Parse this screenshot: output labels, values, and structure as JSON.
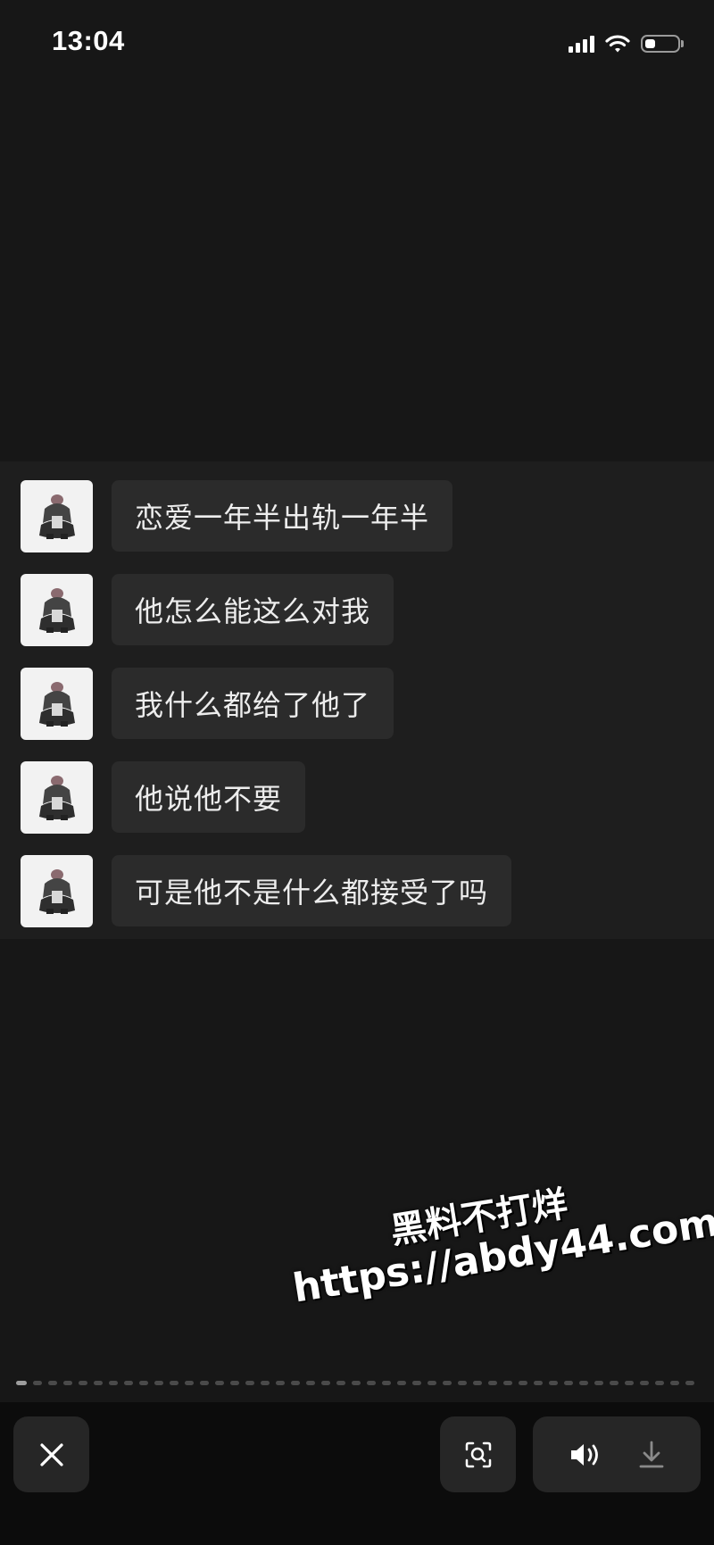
{
  "status_bar": {
    "time": "13:04",
    "icons": [
      "cellular-signal-icon",
      "wifi-icon",
      "battery-icon"
    ]
  },
  "chat": {
    "messages": [
      {
        "text": "恋爱一年半出轨一年半"
      },
      {
        "text": "他怎么能这么对我"
      },
      {
        "text": "我什么都给了他了"
      },
      {
        "text": "他说他不要"
      },
      {
        "text": "可是他不是什么都接受了吗"
      }
    ]
  },
  "watermark": {
    "line1": "黑料不打烊",
    "line2": "https://abdy44.com"
  },
  "bottom_bar": {
    "buttons": [
      "close-icon",
      "scan-search-icon",
      "volume-icon",
      "download-icon"
    ]
  },
  "colors": {
    "background": "#171717",
    "chat_panel": "#1e1e1e",
    "bubble": "#2b2b2b",
    "bottom_bar": "#0c0c0c",
    "button": "#262626"
  }
}
